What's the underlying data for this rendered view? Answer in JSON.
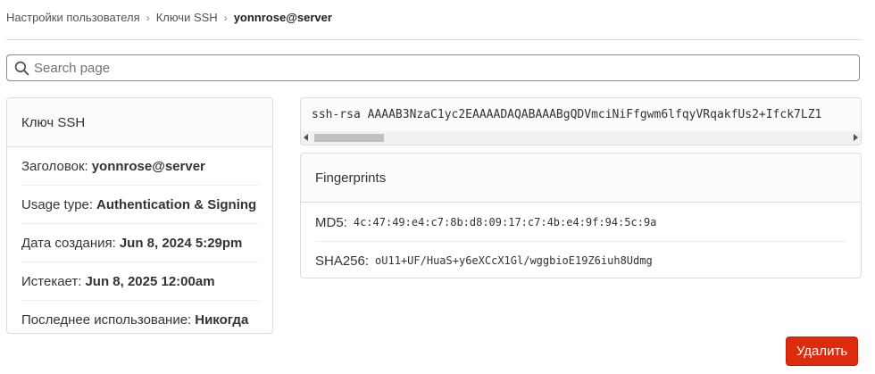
{
  "breadcrumb": {
    "items": [
      "Настройки пользователя",
      "Ключи SSH"
    ],
    "current": "yonnrose@server"
  },
  "search": {
    "placeholder": "Search page",
    "value": ""
  },
  "key_details": {
    "header": "Ключ SSH",
    "rows": [
      {
        "label": "Заголовок:",
        "value": "yonnrose@server"
      },
      {
        "label": "Usage type:",
        "value": "Authentication & Signing"
      },
      {
        "label": "Дата создания:",
        "value": "Jun 8, 2024 5:29pm"
      },
      {
        "label": "Истекает:",
        "value": "Jun 8, 2025 12:00am"
      },
      {
        "label": "Последнее использование:",
        "value": "Никогда"
      }
    ]
  },
  "public_key": {
    "text": "ssh-rsa AAAAB3NzaC1yc2EAAAADAQABAAABgQDVmciNiFfgwm6lfqyVRqakfUs2+Ifck7LZ1"
  },
  "fingerprints": {
    "header": "Fingerprints",
    "rows": [
      {
        "label": "MD5:",
        "value": "4c:47:49:e4:c7:8b:d8:09:17:c7:4b:e4:9f:94:5c:9a"
      },
      {
        "label": "SHA256:",
        "value": "oU11+UF/HuaS+y6eXCcX1Gl/wggbioE19Z6iuh8Udmg"
      }
    ]
  },
  "actions": {
    "delete_label": "Удалить"
  },
  "colors": {
    "danger": "#dd2b0e",
    "border": "#dcdcde",
    "header_bg": "#fbfafd"
  }
}
